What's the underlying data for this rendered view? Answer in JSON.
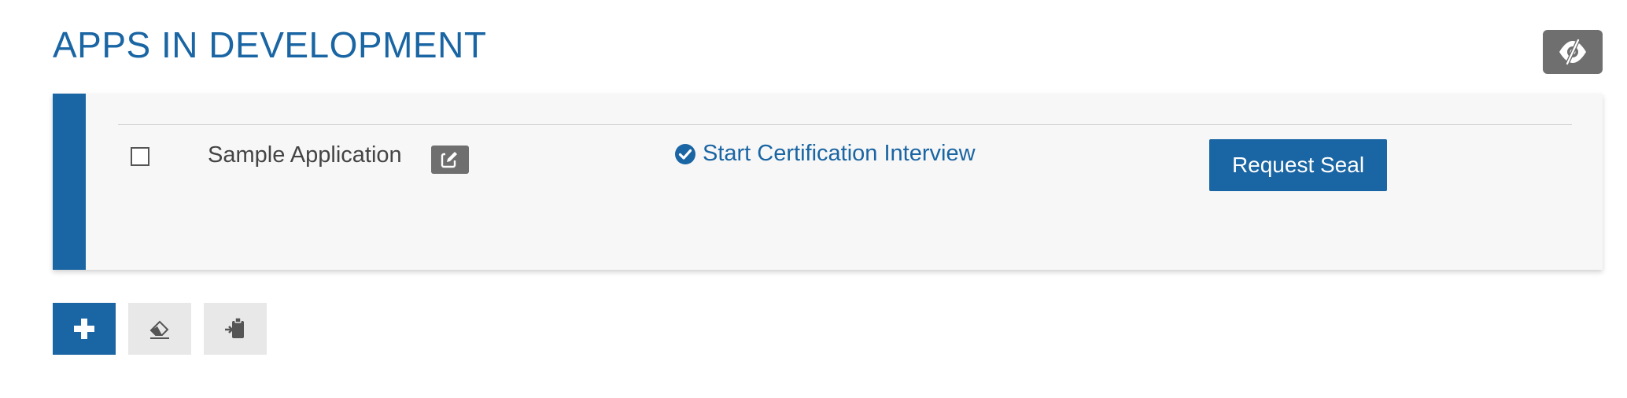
{
  "page": {
    "title": "APPS IN DEVELOPMENT"
  },
  "header": {
    "visibility_toggle_icon": "eye-slash-icon"
  },
  "apps": [
    {
      "name": "Sample Application",
      "checked": false,
      "edit_icon": "edit-icon",
      "certification_link_label": "Start Certification Interview",
      "certification_icon": "check-circle-icon",
      "request_seal_label": "Request Seal"
    }
  ],
  "toolbar": {
    "add_icon": "plus-icon",
    "erase_icon": "eraser-icon",
    "paste_icon": "clipboard-paste-icon"
  },
  "colors": {
    "accent": "#1a65a3",
    "icon_button_gray": "#6f6f6f",
    "card_background": "#f7f7f7",
    "toolbar_secondary": "#e8e8e8",
    "text_dark": "#444444"
  }
}
